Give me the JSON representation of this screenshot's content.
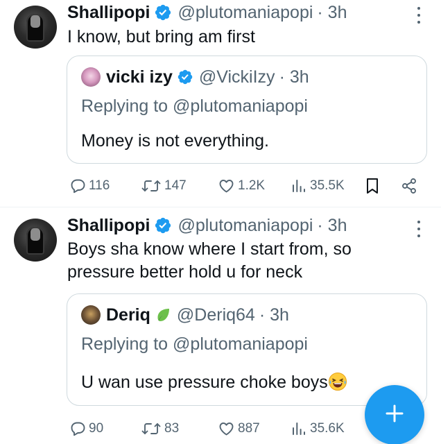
{
  "tweets": [
    {
      "author": {
        "name": "Shallipopi",
        "handle": "@plutomaniapopi",
        "time": "· 3h"
      },
      "text_lines": [
        "I know, but bring am first"
      ],
      "quote": {
        "name": "vicki izy",
        "handle": "@VickiIzy",
        "time": "· 3h",
        "replying_prefix": "Replying to ",
        "replying_handle": "@plutomaniapopi",
        "text": "Money is not everything."
      },
      "stats": {
        "replies": "116",
        "retweets": "147",
        "likes": "1.2K",
        "views": "35.5K"
      }
    },
    {
      "author": {
        "name": "Shallipopi",
        "handle": "@plutomaniapopi",
        "time": "· 3h"
      },
      "text_lines": [
        "Boys sha know where I start from, so",
        "pressure better hold u for neck"
      ],
      "quote": {
        "name": "Deriq",
        "handle": "@Deriq64",
        "time": "· 3h",
        "replying_prefix": "Replying to ",
        "replying_handle": "@plutomaniapopi",
        "text": "U wan use pressure choke boys"
      },
      "stats": {
        "replies": "90",
        "retweets": "83",
        "likes": "887",
        "views": "35.6K"
      }
    }
  ],
  "icons": {
    "verified": "verified-badge-icon",
    "reply": "reply-icon",
    "retweet": "retweet-icon",
    "like": "heart-icon",
    "views": "views-icon",
    "bookmark": "bookmark-icon",
    "share": "share-icon",
    "more": "more-icon",
    "compose": "plus-icon",
    "leaf_emoji": "leaf-icon",
    "laugh_emoji": "laughing-emoji-icon"
  },
  "colors": {
    "accent": "#1d9bf0",
    "text": "#0f1419",
    "secondary": "#536471",
    "border": "#cfd9de"
  }
}
